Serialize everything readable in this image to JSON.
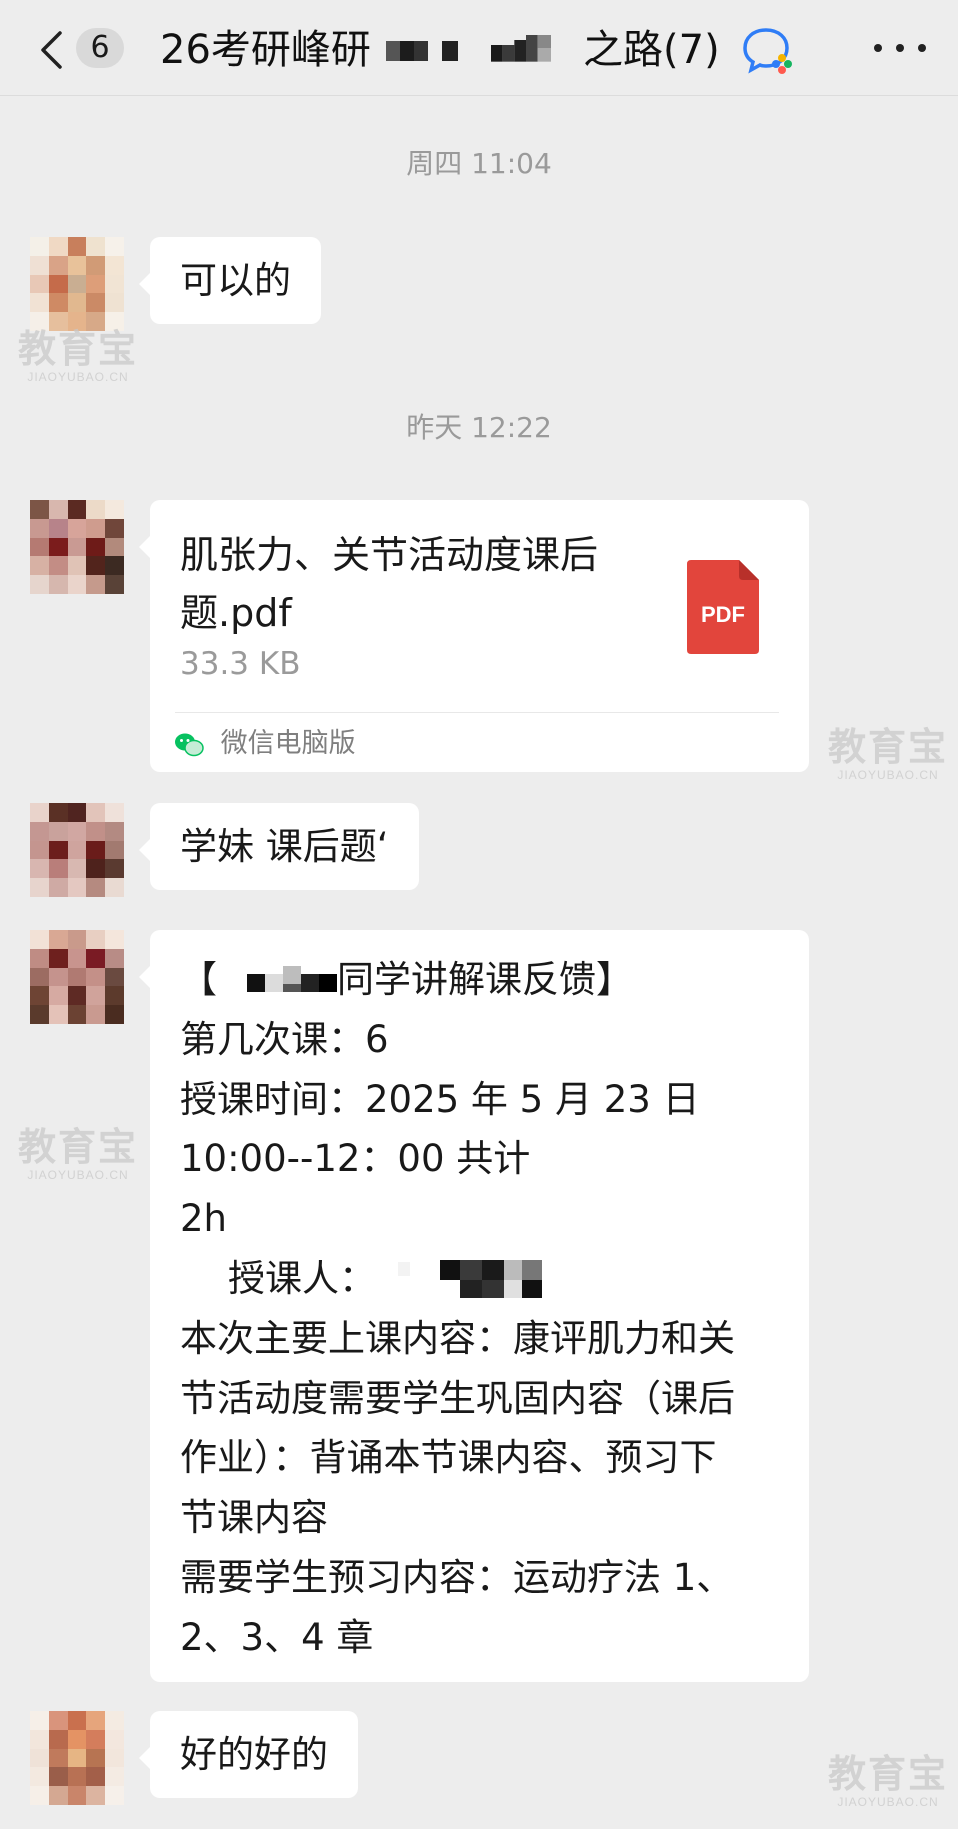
{
  "header": {
    "unread_count": "6",
    "title_prefix": "26考研峰研",
    "title_suffix": "之路(7)",
    "back_icon": "chevron-left-icon",
    "group_icon": "wecom-group-icon",
    "more_icon": "more-icon"
  },
  "timestamps": [
    "周四 11:04",
    "昨天 12:22"
  ],
  "messages": {
    "m1": {
      "text": "可以的"
    },
    "m2": {
      "file_name": "肌张力、关节活动度课后题.pdf",
      "file_size": "33.3 KB",
      "file_type": "PDF",
      "source": "微信电脑版"
    },
    "m3": {
      "text": "学妹 课后题‘"
    },
    "m4": {
      "line1_open": "【",
      "line1_rest": "同学讲解课反馈】",
      "line2": "第几次课：6",
      "line3": "授课时间：2025 年 5 月 23 日",
      "line4": "10:00--12：00 共计",
      "line5": "2h",
      "line6": "授课人：",
      "line7": "本次主要上课内容：康评肌力和关",
      "line8": "节活动度需要学生巩固内容（课后",
      "line9": "作业）：背诵本节课内容、预习下",
      "line10": "节课内容",
      "line11": "需要学生预习内容：运动疗法 1、",
      "line12": "2、3、4 章"
    },
    "m5": {
      "text": "好的好的"
    }
  },
  "watermark": {
    "cn": "教育宝",
    "en": "JIAOYUBAO.CN"
  },
  "colors": {
    "background": "#ededed",
    "bubble": "#ffffff",
    "pdf_red": "#e2453c",
    "wechat_green": "#07c160",
    "timestamp_gray": "#9a9a9a"
  }
}
